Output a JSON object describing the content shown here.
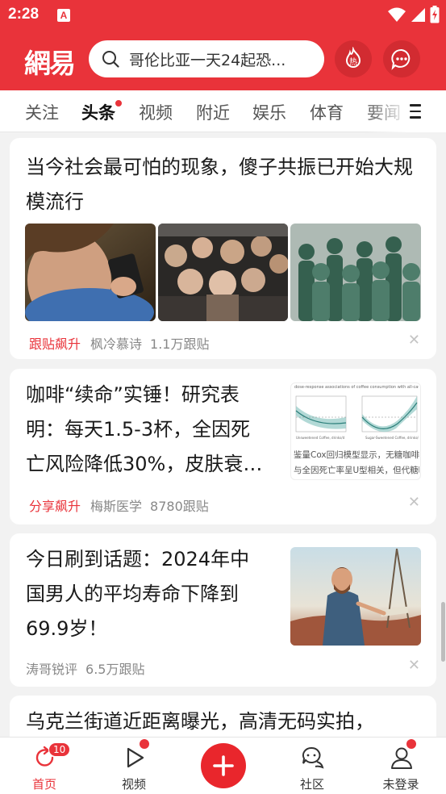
{
  "status_bar": {
    "time": "2:28",
    "app_icon_letter": "A"
  },
  "header": {
    "logo": "網易",
    "search": {
      "placeholder": "哥伦比亚一天24起恐..."
    },
    "hot_label": "热"
  },
  "tabs": [
    {
      "label": "关注"
    },
    {
      "label": "头条",
      "active": true,
      "dot": true
    },
    {
      "label": "视频"
    },
    {
      "label": "附近"
    },
    {
      "label": "娱乐"
    },
    {
      "label": "体育"
    },
    {
      "label": "要闻"
    }
  ],
  "feed": [
    {
      "title": "当今社会最可怕的现象，傻子共振已开始大规模流行",
      "tag": "跟贴飙升",
      "source": "枫冷慕诗",
      "comments": "1.1万跟贴"
    },
    {
      "title": "咖啡“续命”实锤！研究表明：每天1.5-3杯，全因死亡风险降低30%，皮肤衰…",
      "tag": "分享飙升",
      "source": "梅斯医学",
      "comments": "8780跟贴",
      "thumb_text": {
        "top": "dose-response associations of coffee consumption with all-cause (top), cancer (middle)",
        "left_caption": "Unsweetened Coffee, drinks/d",
        "right_caption": "Sugar-Sweetened Coffee, drinks/d",
        "bottom_line1": "鉴量Cox回归模型显示，无糖咖啡和",
        "bottom_line2": "与全因死亡率呈U型相关，但代糖咖"
      }
    },
    {
      "title": "今日刷到话题：2024年中国男人的平均寿命下降到69.9岁！",
      "source": "涛哥锐评",
      "comments": "6.5万跟贴"
    },
    {
      "title": "乌克兰街道近距离曝光，高清无码实拍，"
    }
  ],
  "tabbar": [
    {
      "label": "首页",
      "active": true,
      "badge": "10"
    },
    {
      "label": "视频",
      "dot": true
    },
    {
      "label": "发布"
    },
    {
      "label": "社区"
    },
    {
      "label": "未登录",
      "dot": true
    }
  ],
  "colors": {
    "brand": "#e9333a",
    "text": "#222222",
    "muted": "#888888"
  }
}
